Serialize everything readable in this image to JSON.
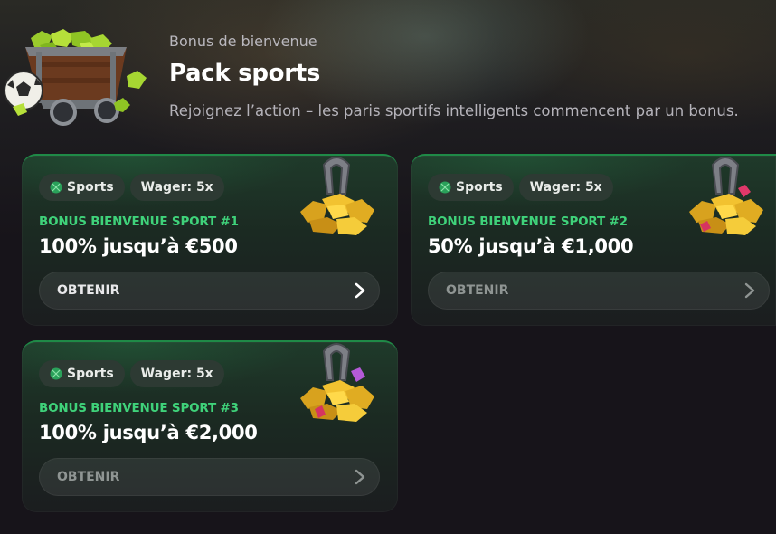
{
  "header": {
    "eyebrow": "Bonus de bienvenue",
    "title": "Pack sports",
    "subtitle": "Rejoignez l’action – les paris sportifs intelligents commencent par un bonus."
  },
  "colors": {
    "accent_green": "#3fd27a",
    "card_border": "#1f8a47",
    "background": "#17141a"
  },
  "cards": [
    {
      "tag_sport": "Sports",
      "tag_wager": "Wager: 5x",
      "label": "BONUS BIENVENUE SPORT #1",
      "amount": "100% jusqu’à €500",
      "button": "OBTENIR",
      "button_state": "active"
    },
    {
      "tag_sport": "Sports",
      "tag_wager": "Wager: 5x",
      "label": "BONUS BIENVENUE SPORT #2",
      "amount": "50% jusqu’à €1,000",
      "button": "OBTENIR",
      "button_state": "dimmed"
    },
    {
      "tag_sport": "Sports",
      "tag_wager": "Wager: 5x",
      "label": "BONUS BIENVENUE SPORT #3",
      "amount": "100% jusqu’à €2,000",
      "button": "OBTENIR",
      "button_state": "dimmed"
    }
  ],
  "icons": {
    "hero": "mine-cart-with-gems-and-football-icon",
    "card_art": "horseshoe-on-gold-pile-icon",
    "tag": "sports-ball-icon",
    "button": "chevron-right-icon"
  }
}
